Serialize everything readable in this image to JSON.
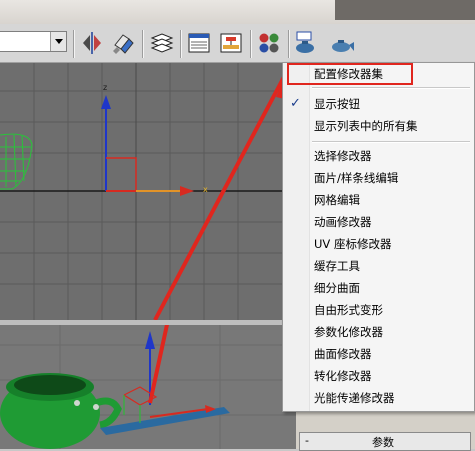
{
  "toolbar": {
    "dropdown_value": "",
    "icons": [
      "mirror-icon",
      "align-icon",
      "layer-manager-icon",
      "curve-editor-icon",
      "schematic-view-icon",
      "material-editor-icon",
      "render-setup-icon",
      "render-icon"
    ]
  },
  "menu": {
    "items": [
      {
        "label": "配置修改器集",
        "highlighted": true
      },
      {
        "label": "显示按钮",
        "checked": true
      },
      {
        "label": "显示列表中的所有集"
      },
      {
        "label": "选择修改器"
      },
      {
        "label": "面片/样条线编辑"
      },
      {
        "label": "网格编辑"
      },
      {
        "label": "动画修改器"
      },
      {
        "label": "UV 座标修改器"
      },
      {
        "label": "缓存工具"
      },
      {
        "label": "细分曲面"
      },
      {
        "label": "自由形式变形"
      },
      {
        "label": "参数化修改器"
      },
      {
        "label": "曲面修改器"
      },
      {
        "label": "转化修改器"
      },
      {
        "label": "光能传递修改器"
      }
    ]
  },
  "panel": {
    "rollout_minus": "-",
    "rollout_label": "参数"
  },
  "gizmo": {
    "z_label": "z",
    "x_label": "x"
  },
  "colors": {
    "annotation": "#e0261e",
    "grid_line": "#5a5a5a",
    "viewport_bg": "#6e6e6e",
    "teapot": "#1fa53a"
  }
}
